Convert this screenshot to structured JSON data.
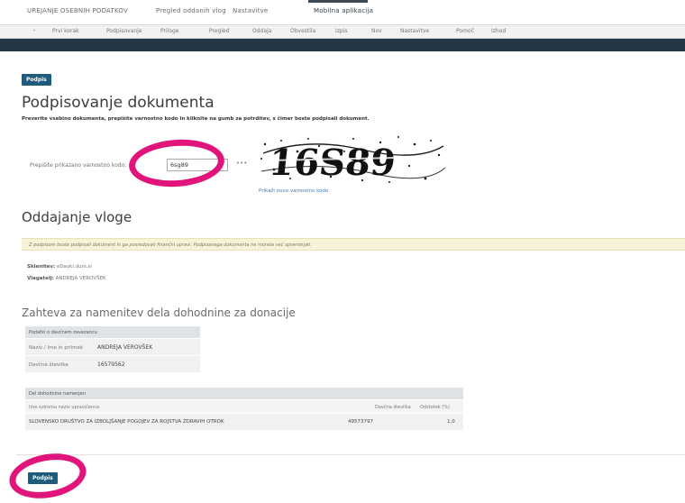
{
  "topnav": {
    "tabs": [
      "UREJANJE OSEBNIH PODATKOV",
      "Pregled oddanih vlog",
      "Nastavitve",
      "Mobilna aplikacija"
    ]
  },
  "subnav": {
    "items": [
      "Prvi korak",
      "Podpisovanje",
      "Priloge",
      "Pregled",
      "Oddaja",
      "Obvestila",
      "Izpis",
      "Nov",
      "Nastavitve",
      "Pomoč",
      "Izhod"
    ]
  },
  "buttons": {
    "sign_top": "Podpis",
    "sign_bottom": "Podpis"
  },
  "signing": {
    "title": "Podpisovanje dokumenta",
    "instruction": "Preverite vsebino dokumenta, prepišite varnostno kodo in kliknite na gumb za potrditev, s čimer boste podpisali dokument.",
    "code_label": "Prepišite prikazano varnostno kodo:",
    "code_value": "6sg89",
    "dots": "•••",
    "captcha_text": "16S89",
    "new_code_link": "Prikaži novo varnostno kodo"
  },
  "submission": {
    "title": "Oddajanje vloge",
    "notice": "Z podpisom boste podpisali dokument in ga posredovali finančni upravi. Podpisanega dokumenta ne morete več spreminjati.",
    "meta": [
      {
        "label": "Sklenitev:",
        "value": "eDavki.durs.si"
      },
      {
        "label": "Vlagatelj:",
        "value": "ANDREJA VEROVŠEK"
      }
    ]
  },
  "request": {
    "title": "Zahteva za namenitev dela dohodnine za donacije",
    "taxpayer_header": "Podatki o davčnem zavezancu",
    "taxpayer_rows": [
      {
        "label": "Naziv / Ime in priimek",
        "value": "ANDREJA VEROVŠEK"
      },
      {
        "label": "Davčna številka",
        "value": "16579562"
      }
    ],
    "donation_header": "Del dohodnine namenjen",
    "columns": [
      "Ime oziroma naziv upravičenca",
      "Davčna številka",
      "Odstotek (%)"
    ],
    "rows": [
      {
        "name": "SLOVENSKO DRUŠTVO ZA IZBOLJŠANJE POGOJEV ZA ROJSTVA ZDRAVIH OTROK",
        "tax": "49573797",
        "pct": "1,0"
      }
    ]
  },
  "colors": {
    "primary_button": "#1f5b7c",
    "dark_band": "#233645",
    "annotation": "#e0147a",
    "notice_bg": "#f6f3d8"
  }
}
